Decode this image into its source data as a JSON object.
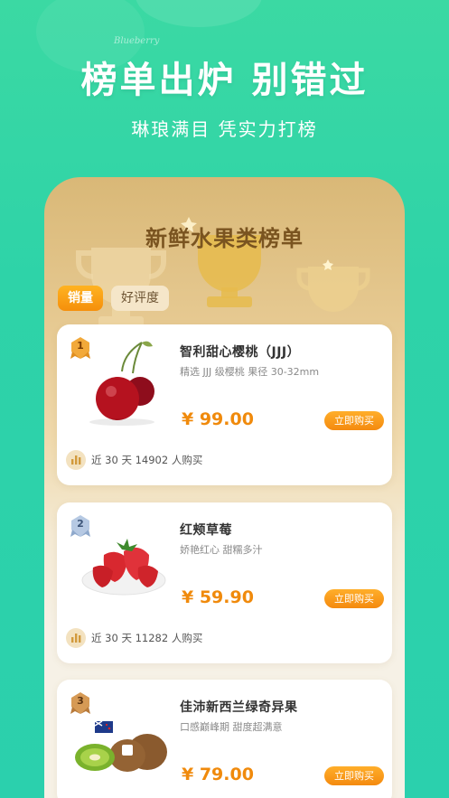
{
  "hero": {
    "title": "榜单出炉 别错过",
    "subtitle": "琳琅满目 凭实力打榜",
    "deco_script": "Blueberry"
  },
  "panel": {
    "title": "新鲜水果类榜单",
    "tabs": [
      {
        "label": "销量",
        "active": true
      },
      {
        "label": "好评度",
        "active": false
      }
    ]
  },
  "products": [
    {
      "rank": "1",
      "name": "智利甜心樱桃（JJJ）",
      "desc": "精选 JJJ 级樱桃 果径 30-32mm",
      "price": "¥ 99.00",
      "buy_label": "立即购买",
      "sales": "近 30 天 14902 人购买",
      "image": "cherry-image",
      "badge_color": "#f2a93a"
    },
    {
      "rank": "2",
      "name": "红颊草莓",
      "desc": "娇艳红心 甜糯多汁",
      "price": "¥ 59.90",
      "buy_label": "立即购买",
      "sales": "近 30 天 11282 人购买",
      "image": "strawberry-image",
      "badge_color": "#a9c1e0"
    },
    {
      "rank": "3",
      "name": "佳沛新西兰绿奇异果",
      "desc": "口感巅峰期 甜度超满意",
      "price": "¥ 79.00",
      "buy_label": "立即购买",
      "sales": "",
      "image": "kiwi-image",
      "badge_color": "#d3934d"
    }
  ],
  "colors": {
    "accent": "#f48a0f",
    "background": "#2ed3a8",
    "panel_title": "#7a5420"
  }
}
